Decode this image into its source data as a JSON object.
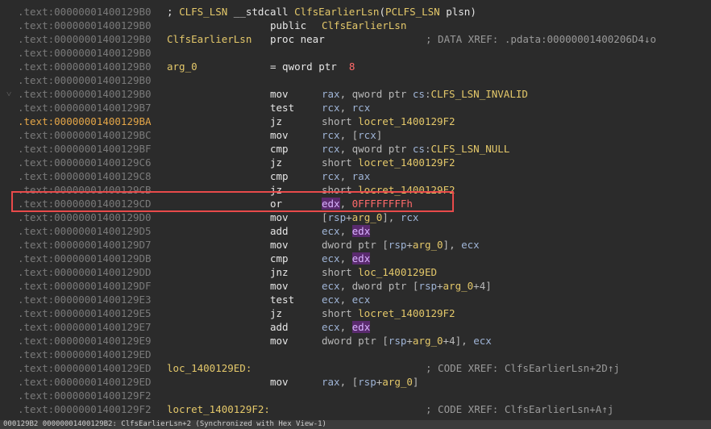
{
  "listing": {
    "rows": [
      {
        "addr": ".text:00000001400129B0",
        "full": "; CLFS_LSN __stdcall ClfsEarlierLsn(PCLFS_LSN plsn)"
      },
      {
        "addr": ".text:00000001400129B0",
        "mnem": "public",
        "ops": "ClfsEarlierLsn"
      },
      {
        "addr": ".text:00000001400129B0",
        "label": "ClfsEarlierLsn",
        "mnem": "proc near",
        "cmt": "; DATA XREF: .pdata:00000001400206D4↓o"
      },
      {
        "addr": ".text:00000001400129B0"
      },
      {
        "addr": ".text:00000001400129B0",
        "label": "arg_0",
        "mnem": "= qword ptr  8"
      },
      {
        "addr": ".text:00000001400129B0"
      },
      {
        "addr": ".text:00000001400129B0",
        "mnem": "mov",
        "ops": "rax, qword ptr cs:CLFS_LSN_INVALID"
      },
      {
        "addr": ".text:00000001400129B7",
        "mnem": "test",
        "ops": "rcx, rcx"
      },
      {
        "addr": ".text:00000001400129BA",
        "hl": true,
        "mnem": "jz",
        "ops": "short locret_1400129F2"
      },
      {
        "addr": ".text:00000001400129BC",
        "mnem": "mov",
        "ops": "rcx, [rcx]"
      },
      {
        "addr": ".text:00000001400129BF",
        "mnem": "cmp",
        "ops": "rcx, qword ptr cs:CLFS_LSN_NULL"
      },
      {
        "addr": ".text:00000001400129C6",
        "mnem": "jz",
        "ops": "short locret_1400129F2"
      },
      {
        "addr": ".text:00000001400129C8",
        "mnem": "cmp",
        "ops": "rcx, rax"
      },
      {
        "addr": ".text:00000001400129CB",
        "mnem": "jz",
        "ops": "short locret_1400129F2"
      },
      {
        "addr": ".text:00000001400129CD",
        "mnem": "or",
        "ops": "edx, 0FFFFFFFFh"
      },
      {
        "addr": ".text:00000001400129D0",
        "mnem": "mov",
        "ops": "[rsp+arg_0], rcx"
      },
      {
        "addr": ".text:00000001400129D5",
        "mnem": "add",
        "ops": "ecx, edx"
      },
      {
        "addr": ".text:00000001400129D7",
        "mnem": "mov",
        "ops": "dword ptr [rsp+arg_0], ecx"
      },
      {
        "addr": ".text:00000001400129DB",
        "mnem": "cmp",
        "ops": "ecx, edx"
      },
      {
        "addr": ".text:00000001400129DD",
        "mnem": "jnz",
        "ops": "short loc_1400129ED"
      },
      {
        "addr": ".text:00000001400129DF",
        "mnem": "mov",
        "ops": "ecx, dword ptr [rsp+arg_0+4]"
      },
      {
        "addr": ".text:00000001400129E3",
        "mnem": "test",
        "ops": "ecx, ecx"
      },
      {
        "addr": ".text:00000001400129E5",
        "mnem": "jz",
        "ops": "short locret_1400129F2"
      },
      {
        "addr": ".text:00000001400129E7",
        "mnem": "add",
        "ops": "ecx, edx"
      },
      {
        "addr": ".text:00000001400129E9",
        "mnem": "mov",
        "ops": "dword ptr [rsp+arg_0+4], ecx"
      },
      {
        "addr": ".text:00000001400129ED"
      },
      {
        "addr": ".text:00000001400129ED",
        "label": "loc_1400129ED:",
        "cmt": "; CODE XREF: ClfsEarlierLsn+2D↑j"
      },
      {
        "addr": ".text:00000001400129ED",
        "mnem": "mov",
        "ops": "rax, [rsp+arg_0]"
      },
      {
        "addr": ".text:00000001400129F2"
      },
      {
        "addr": ".text:00000001400129F2",
        "label": "locret_1400129F2:",
        "cmt": "; CODE XREF: ClfsEarlierLsn+A↑j"
      }
    ]
  },
  "statusbar": {
    "text": "000129B2 00000001400129B2: ClfsEarlierLsn+2   (Synchronized with Hex View-1)"
  },
  "colors": {
    "background": "#2b2b2b",
    "highlight_border": "#e84a4a",
    "label": "#e4c86a"
  }
}
